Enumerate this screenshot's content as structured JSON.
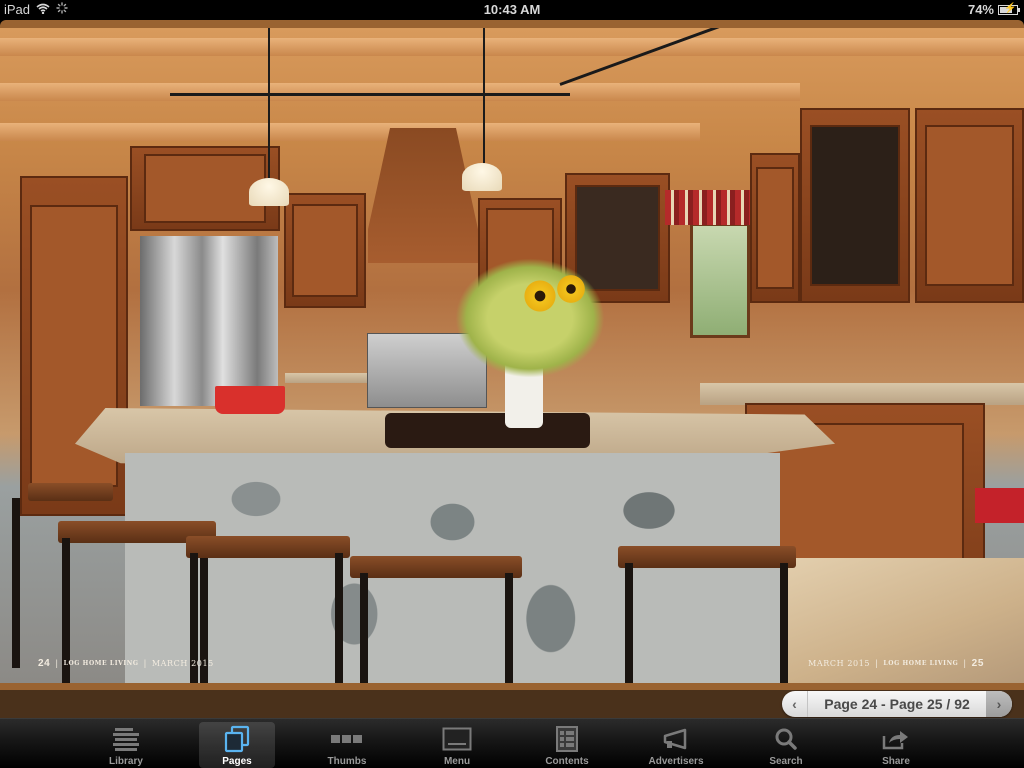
{
  "status_bar": {
    "device": "iPad",
    "time": "10:43 AM",
    "battery_percent": "74%",
    "battery_level": 0.74,
    "wifi_icon": "wifi-icon",
    "activity_icon": "activity-spinner-icon",
    "battery_icon": "battery-charging-icon"
  },
  "magazine": {
    "left_page": {
      "page_number": "24",
      "publication": "LOG HOME LIVING",
      "issue": "MARCH 2015"
    },
    "right_page": {
      "page_number": "25",
      "publication": "LOG HOME LIVING",
      "issue": "MARCH 2015"
    },
    "separator": "|",
    "photo_description": "Rustic log-home kitchen with stone island, bar stools, and wood cabinets"
  },
  "page_navigator": {
    "prev_icon": "chevron-left-icon",
    "label": "Page 24 - Page 25 / 92",
    "next_icon": "chevron-right-icon"
  },
  "tab_bar": {
    "items": [
      {
        "label": "Library",
        "icon": "library-list-icon",
        "active": false
      },
      {
        "label": "Pages",
        "icon": "pages-icon",
        "active": true
      },
      {
        "label": "Thumbs",
        "icon": "thumbs-icon",
        "active": false
      },
      {
        "label": "Menu",
        "icon": "menu-screen-icon",
        "active": false
      },
      {
        "label": "Contents",
        "icon": "contents-grid-icon",
        "active": false
      },
      {
        "label": "Advertisers",
        "icon": "megaphone-icon",
        "active": false
      },
      {
        "label": "Search",
        "icon": "search-icon",
        "active": false
      },
      {
        "label": "Share",
        "icon": "share-icon",
        "active": false
      }
    ]
  },
  "colors": {
    "frame": "#9a6331",
    "nav_strip": "#4a311b",
    "active_tab_icon": "#5ab4f0",
    "tab_text": "#9a9a9a"
  }
}
